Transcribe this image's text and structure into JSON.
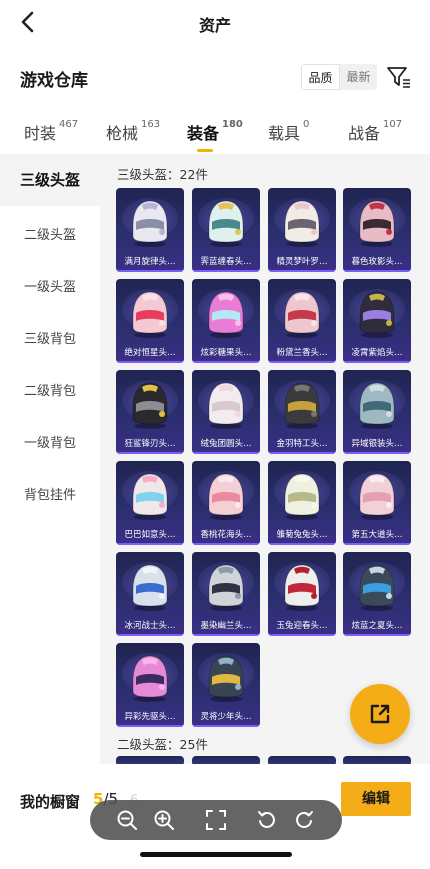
{
  "header": {
    "title": "资产"
  },
  "repo": {
    "title": "游戏仓库",
    "sort": {
      "quality_label": "品质",
      "latest_label": "最新"
    }
  },
  "tabs": [
    {
      "label": "时装",
      "count": "467"
    },
    {
      "label": "枪械",
      "count": "163"
    },
    {
      "label": "装备",
      "count": "180"
    },
    {
      "label": "载具",
      "count": "0"
    },
    {
      "label": "战备",
      "count": "107"
    }
  ],
  "sidebar": {
    "items": [
      {
        "label": "三级头盔"
      },
      {
        "label": "二级头盔"
      },
      {
        "label": "一级头盔"
      },
      {
        "label": "三级背包"
      },
      {
        "label": "二级背包"
      },
      {
        "label": "一级背包"
      },
      {
        "label": "背包挂件"
      }
    ]
  },
  "sections": [
    {
      "title": "三级头盔：22件",
      "items": [
        {
          "name": "满月旋律头…",
          "shell": "#e9e7ef",
          "visor": "#8a8fa8",
          "accent": "#b9b2d8"
        },
        {
          "name": "霁蓝缠春头…",
          "shell": "#dff1ef",
          "visor": "#4a8a8c",
          "accent": "#e2c25a"
        },
        {
          "name": "精灵梦叶罗…",
          "shell": "#f2ece6",
          "visor": "#6a6470",
          "accent": "#e9c6d0"
        },
        {
          "name": "暮色玫影头…",
          "shell": "#e8bcc4",
          "visor": "#3a2a36",
          "accent": "#c2344e"
        },
        {
          "name": "绝对恒星头…",
          "shell": "#f4c9d3",
          "visor": "#e63e5f",
          "accent": "#f7e2e7"
        },
        {
          "name": "炫彩糖果头…",
          "shell": "#e97dd6",
          "visor": "#b5e8f5",
          "accent": "#f7c0ea"
        },
        {
          "name": "粉黛兰香头…",
          "shell": "#eec6cd",
          "visor": "#c43a4a",
          "accent": "#f8e5e8"
        },
        {
          "name": "凌霄紫焰头…",
          "shell": "#2f2d3c",
          "visor": "#9a7fe0",
          "accent": "#c6b34a"
        },
        {
          "name": "狂鲨锋刃头…",
          "shell": "#2a2a2e",
          "visor": "#8c8c92",
          "accent": "#e0c24a"
        },
        {
          "name": "绒兔团圆头…",
          "shell": "#f3ecef",
          "visor": "#d9c8cf",
          "accent": "#f2d7e0"
        },
        {
          "name": "金羽特工头…",
          "shell": "#3b3b3b",
          "visor": "#c8a040",
          "accent": "#777"
        },
        {
          "name": "异域银装头…",
          "shell": "#9fb9c3",
          "visor": "#3f6b78",
          "accent": "#d0dee2"
        },
        {
          "name": "巴巴如意头…",
          "shell": "#f1e6ea",
          "visor": "#7fd2ea",
          "accent": "#f4b0c2"
        },
        {
          "name": "香桃花海头…",
          "shell": "#f4cfd6",
          "visor": "#ea8aa0",
          "accent": "#fbe9ee"
        },
        {
          "name": "雏菊兔兔头…",
          "shell": "#eef1df",
          "visor": "#b8b98a",
          "accent": "#f8f8ee"
        },
        {
          "name": "第五大道头…",
          "shell": "#f2d0d8",
          "visor": "#e4a0b2",
          "accent": "#fbeef2"
        },
        {
          "name": "冰河战士头…",
          "shell": "#d8e0ec",
          "visor": "#3a6bd0",
          "accent": "#f2f4f8"
        },
        {
          "name": "墨染幽兰头…",
          "shell": "#d0d4d8",
          "visor": "#2f3440",
          "accent": "#8a9aa8"
        },
        {
          "name": "玉兔迎春头…",
          "shell": "#eeeeee",
          "visor": "#c0283a",
          "accent": "#b5202e"
        },
        {
          "name": "炫蓝之夏头…",
          "shell": "#3a4a5a",
          "visor": "#3a9fdf",
          "accent": "#c9d6e0"
        },
        {
          "name": "异彩先驱头…",
          "shell": "#e68ad8",
          "visor": "#3b2b63",
          "accent": "#f7b6ea"
        },
        {
          "name": "灵将少年头…",
          "shell": "#394552",
          "visor": "#e2b743",
          "accent": "#8fb3cc"
        }
      ]
    },
    {
      "title": "二级头盔：25件",
      "items": []
    }
  ],
  "showcase": {
    "label": "我的橱窗",
    "current": "5",
    "separator": "/",
    "max": "5",
    "extra": "6",
    "edit_label": "编辑"
  },
  "colors": {
    "accent": "#f5ad17",
    "card_top": "#1f2451",
    "card_bottom": "#3a2f86"
  },
  "icons": {
    "back": "chevron-left-icon",
    "filter": "filter-icon",
    "share": "share-external-icon",
    "zoom_out": "zoom-out-icon",
    "zoom_in": "zoom-in-icon",
    "fit": "fit-screen-icon",
    "rotate_left": "rotate-left-icon",
    "rotate_right": "rotate-right-icon"
  }
}
